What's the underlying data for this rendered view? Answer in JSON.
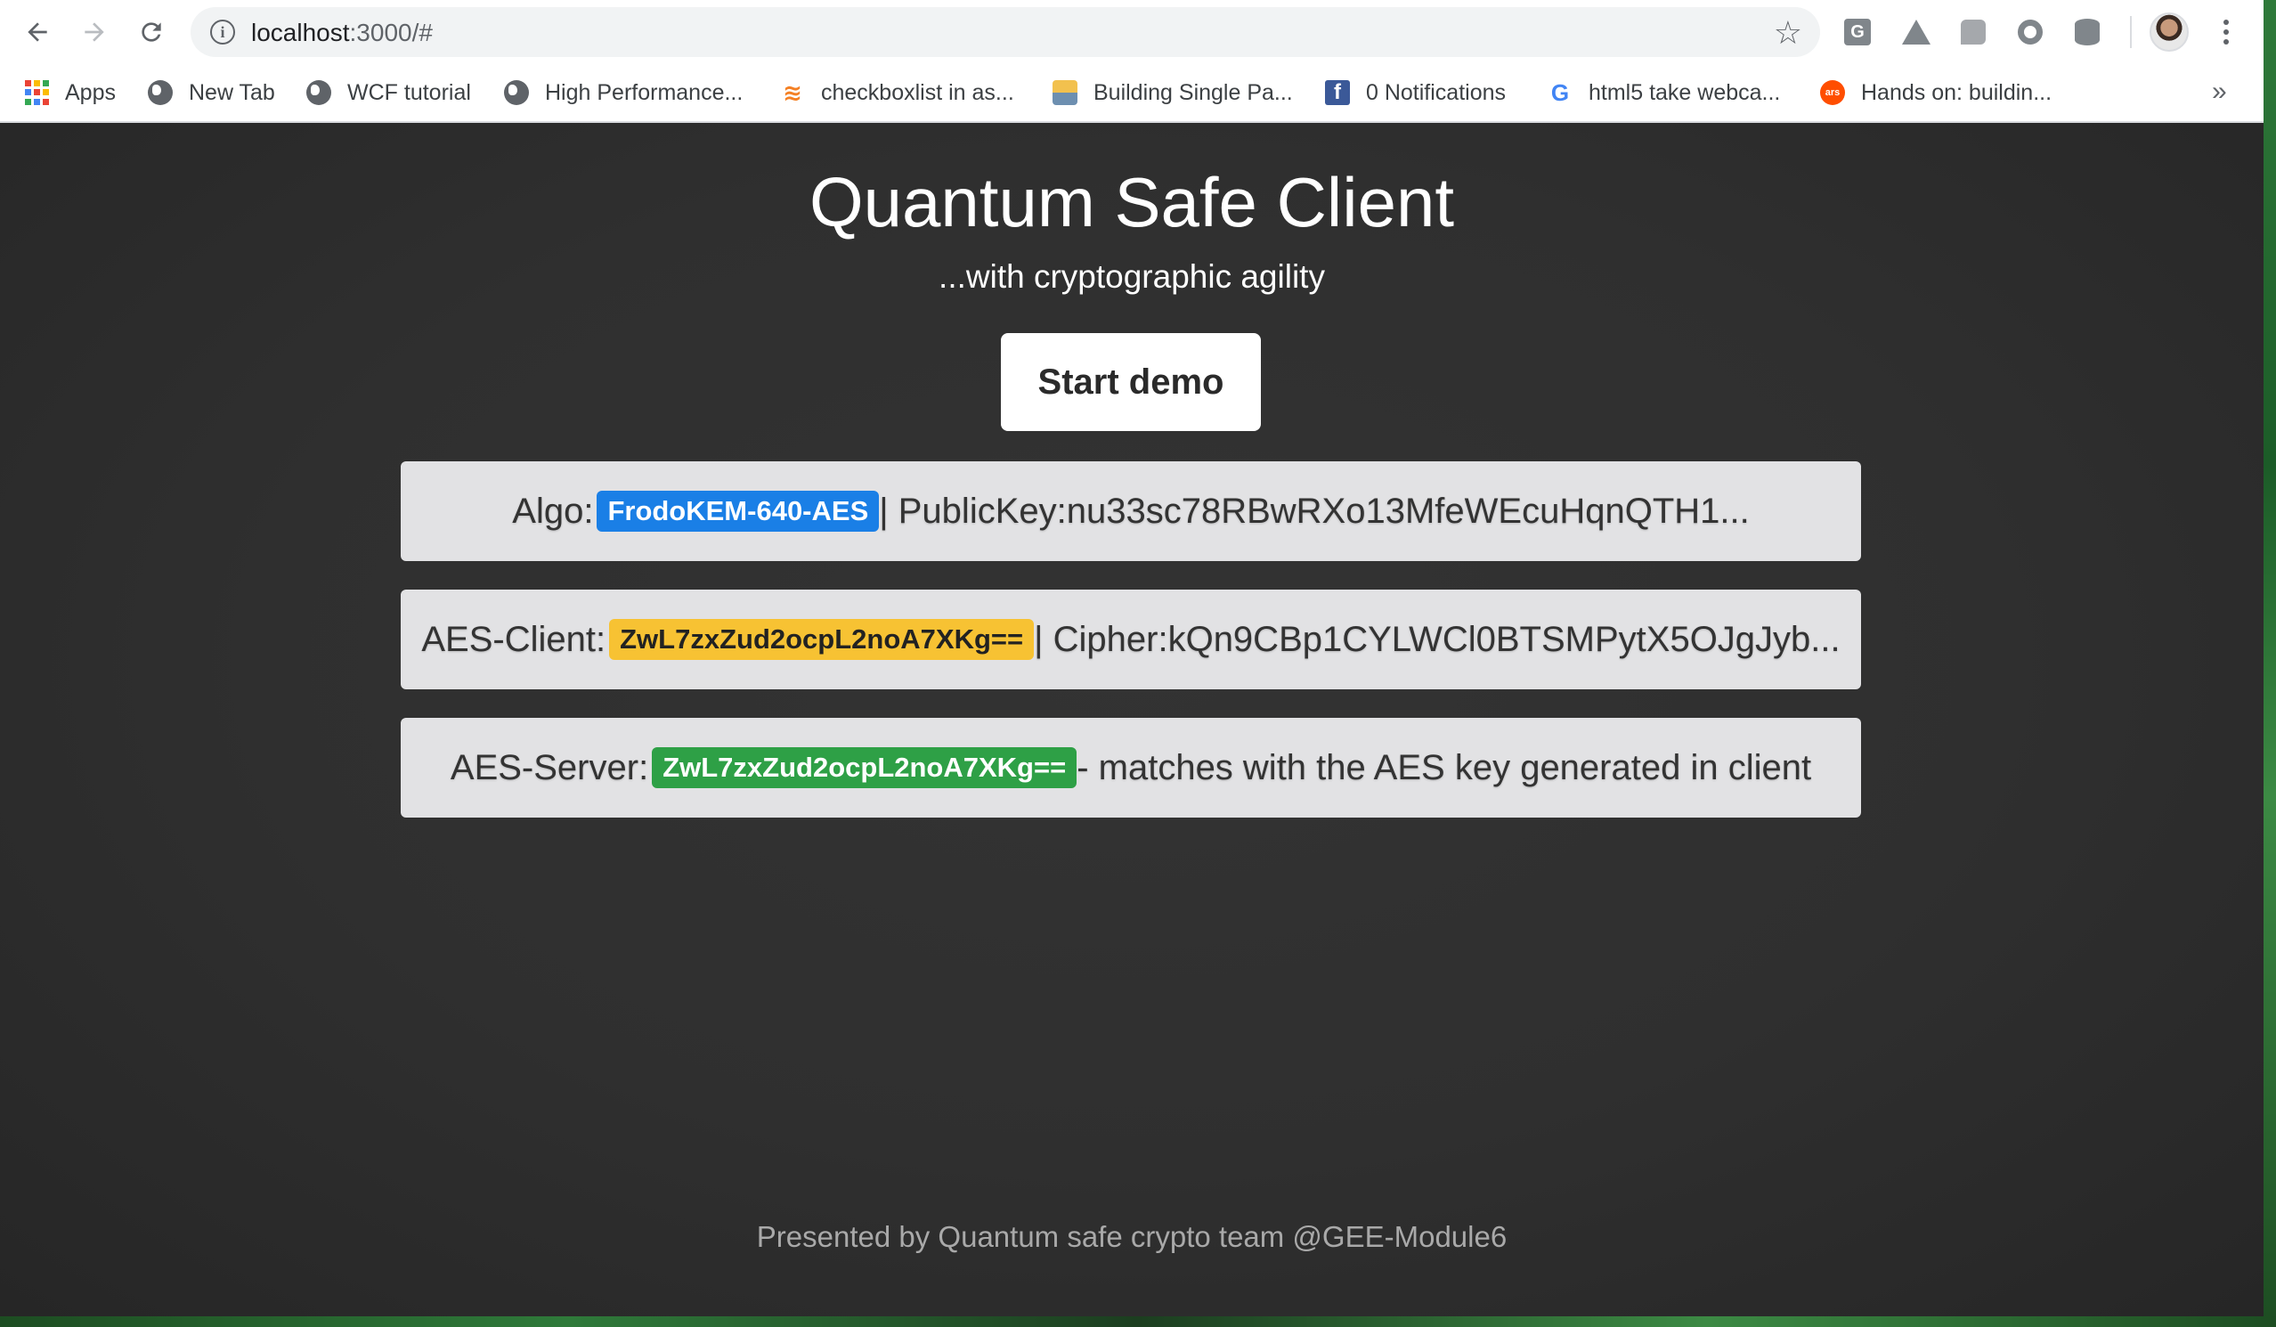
{
  "browser": {
    "url_host": "localhost",
    "url_path": ":3000/#",
    "bookmarks": [
      {
        "label": "Apps",
        "icon": "apps-grid-icon"
      },
      {
        "label": "New Tab",
        "icon": "globe-icon"
      },
      {
        "label": "WCF tutorial",
        "icon": "globe-icon"
      },
      {
        "label": "High Performance...",
        "icon": "globe-icon"
      },
      {
        "label": "checkboxlist in as...",
        "icon": "stackoverflow-icon"
      },
      {
        "label": "Building Single Pa...",
        "icon": "site-favicon-icon"
      },
      {
        "label": "0 Notifications",
        "icon": "facebook-icon"
      },
      {
        "label": "html5 take webca...",
        "icon": "google-icon"
      },
      {
        "label": "Hands on: buildin...",
        "icon": "ars-icon"
      }
    ],
    "bookmarks_overflow": "»",
    "extension_g_label": "G",
    "facebook_glyph": "f",
    "google_glyph": "G",
    "ars_glyph": "ars"
  },
  "page": {
    "title": "Quantum Safe Client",
    "subtitle": "...with cryptographic agility",
    "start_button": "Start demo",
    "algo_panel": {
      "prefix": "Algo:",
      "badge": "FrodoKEM-640-AES",
      "suffix": " | PublicKey:nu33sc78RBwRXo13MfeWEcuHqnQTH1..."
    },
    "client_panel": {
      "prefix": "AES-Client:",
      "badge": "ZwL7zxZud2ocpL2noA7XKg==",
      "suffix": " | Cipher:kQn9CBp1CYLWCl0BTSMPytX5OJgJyb..."
    },
    "server_panel": {
      "prefix": "AES-Server:",
      "badge": "ZwL7zxZud2ocpL2noA7XKg==",
      "suffix": " - matches with the AES key generated in client"
    },
    "footer": "Presented by Quantum safe crypto team @GEE-Module6"
  },
  "colors": {
    "badge_algo": "#1a7fe6",
    "badge_client": "#f7c233",
    "badge_server": "#2ea046",
    "page_background": "#2f2f2f"
  }
}
